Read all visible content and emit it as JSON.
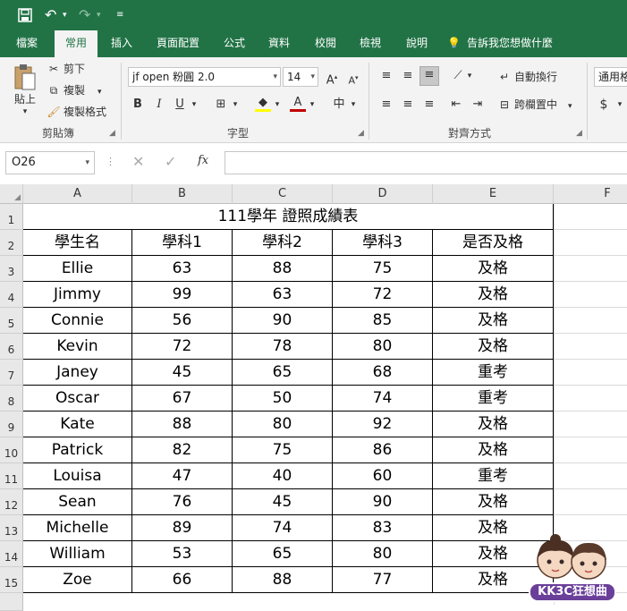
{
  "quick_access": {
    "save_icon": "save-icon",
    "undo_icon": "undo-icon",
    "redo_icon": "redo-icon",
    "customize_icon": "customize-qat-icon"
  },
  "tabs": [
    {
      "label": "檔案"
    },
    {
      "label": "常用"
    },
    {
      "label": "插入"
    },
    {
      "label": "頁面配置"
    },
    {
      "label": "公式"
    },
    {
      "label": "資料"
    },
    {
      "label": "校閱"
    },
    {
      "label": "檢視"
    },
    {
      "label": "說明"
    },
    {
      "label": "告訴我您想做什麼"
    }
  ],
  "ribbon": {
    "clipboard": {
      "paste_label": "貼上",
      "cut_label": "剪下",
      "copy_label": "複製",
      "format_painter_label": "複製格式",
      "group_label": "剪貼簿"
    },
    "font": {
      "font_name": "jf open 粉圓 2.0",
      "font_size": "14",
      "bold": "B",
      "italic": "I",
      "underline": "U",
      "group_label": "字型"
    },
    "alignment": {
      "wrap_text_label": "自動換行",
      "merge_label": "跨欄置中",
      "group_label": "對齊方式"
    },
    "number": {
      "format_value": "通用格式",
      "currency_symbol": "$"
    }
  },
  "formula_bar": {
    "name_box": "O26",
    "fx_label": "fx",
    "formula_value": ""
  },
  "sheet": {
    "columns": [
      "A",
      "B",
      "C",
      "D",
      "E",
      "F"
    ],
    "row_numbers": [
      "1",
      "2",
      "3",
      "4",
      "5",
      "6",
      "7",
      "8",
      "9",
      "10",
      "11",
      "12",
      "13",
      "14",
      "15"
    ],
    "title": "111學年 證照成績表",
    "headers": [
      "學生名",
      "學科1",
      "學科2",
      "學科3",
      "是否及格"
    ],
    "rows": [
      [
        "Ellie",
        "63",
        "88",
        "75",
        "及格"
      ],
      [
        "Jimmy",
        "99",
        "63",
        "72",
        "及格"
      ],
      [
        "Connie",
        "56",
        "90",
        "85",
        "及格"
      ],
      [
        "Kevin",
        "72",
        "78",
        "80",
        "及格"
      ],
      [
        "Janey",
        "45",
        "65",
        "68",
        "重考"
      ],
      [
        "Oscar",
        "67",
        "50",
        "74",
        "重考"
      ],
      [
        "Kate",
        "88",
        "80",
        "92",
        "及格"
      ],
      [
        "Patrick",
        "82",
        "75",
        "86",
        "及格"
      ],
      [
        "Louisa",
        "47",
        "40",
        "60",
        "重考"
      ],
      [
        "Sean",
        "76",
        "45",
        "90",
        "及格"
      ],
      [
        "Michelle",
        "89",
        "74",
        "83",
        "及格"
      ],
      [
        "William",
        "53",
        "65",
        "80",
        "及格"
      ],
      [
        "Zoe",
        "66",
        "88",
        "77",
        "及格"
      ]
    ]
  },
  "watermark": {
    "text": "KK3C狂想曲"
  },
  "colors": {
    "brand": "#217346",
    "ribbon_bg": "#f3f3f3",
    "header_bg": "#e8e8e8"
  }
}
